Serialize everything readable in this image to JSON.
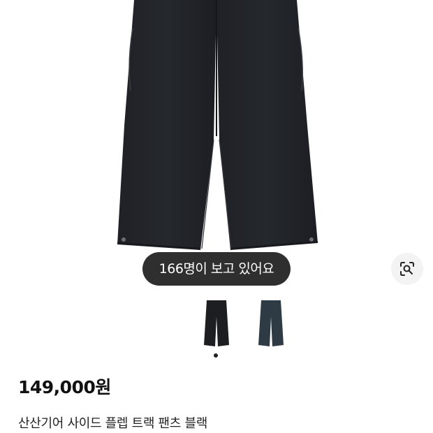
{
  "product": {
    "viewers_text": "166명이 보고 있어요",
    "price": "149,000원",
    "name": "산산기어 사이드 플렙 트랙 팬츠 블랙",
    "image_icon": "pants-image",
    "lens_icon": "lens-search-icon",
    "selected_thumbnail": 0,
    "thumbnails": [
      {
        "color": "#1c1e22"
      },
      {
        "color": "#2f3b44"
      }
    ]
  },
  "colors": {
    "pill_background": "#2f2f2f",
    "lens_background": "#f3f3f3",
    "text_primary": "#111111"
  }
}
